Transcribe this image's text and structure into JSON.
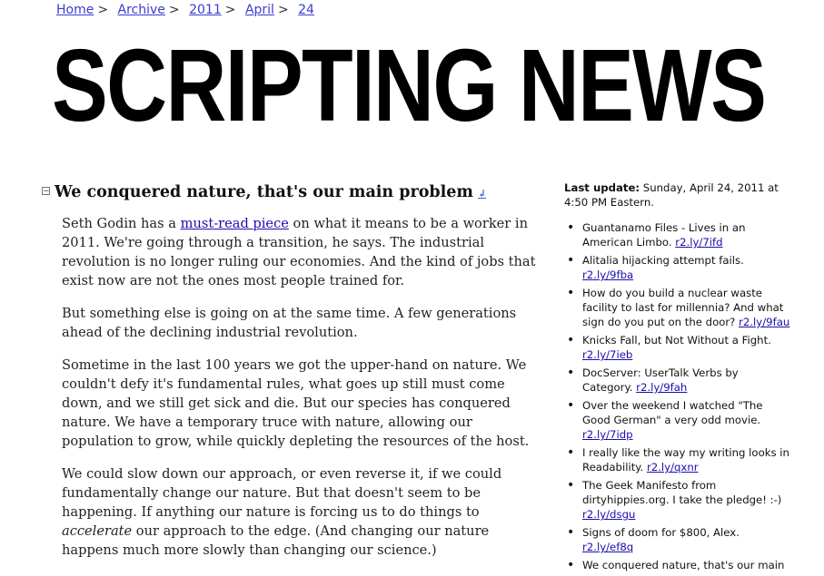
{
  "breadcrumb": [
    "Home",
    "Archive",
    "2011",
    "April",
    "24"
  ],
  "masthead": "SCRIPTING NEWS",
  "post": {
    "title": "We conquered nature, that's our main problem",
    "p1_a": "Seth Godin has a ",
    "p1_link": "must-read piece",
    "p1_b": " on what it means to be a worker in 2011. We're going through a transition, he says. The industrial revolution is no longer ruling our economies. And the kind of jobs that exist now are not the ones most people trained for.",
    "p2": "But something else is going on at the same time. A few generations ahead of the declining industrial revolution.",
    "p3": "Sometime in the last 100 years we got the upper-hand on nature. We couldn't defy it's fundamental rules, what goes up still must come down, and we still get sick and die. But our species has conquered nature. We have a temporary truce with nature, allowing our population to grow, while quickly depleting the resources of the host.",
    "p4_a": "We could slow down our approach, or even reverse it, if we could fundamentally change our nature. But that doesn't seem to be happening. If anything our nature is forcing us to do things to ",
    "p4_em": "accelerate",
    "p4_b": " our approach to the edge. (And changing our nature happens much more slowly than changing our science.)"
  },
  "sidebar": {
    "last_update_label": "Last update:",
    "last_update_value": " Sunday, April 24, 2011 at 4:50 PM Eastern.",
    "links": [
      {
        "text": "Guantanamo Files - Lives in an American Limbo. ",
        "url": "r2.ly/7ifd"
      },
      {
        "text": "Alitalia hijacking attempt fails. ",
        "url": "r2.ly/9fba"
      },
      {
        "text": "How do you build a nuclear waste facility to last for millennia? And what sign do you put on the door? ",
        "url": "r2.ly/9fau"
      },
      {
        "text": "Knicks Fall, but Not Without a Fight. ",
        "url": "r2.ly/7ieb"
      },
      {
        "text": "DocServer: UserTalk Verbs by Category. ",
        "url": "r2.ly/9fah"
      },
      {
        "text": "Over the weekend I watched \"The Good German\" a very odd movie. ",
        "url": "r2.ly/7idp"
      },
      {
        "text": "I really like the way my writing looks in Readability. ",
        "url": "r2.ly/qxnr"
      },
      {
        "text": "The Geek Manifesto from dirtyhippies.org. I take the pledge! :-) ",
        "url": "r2.ly/dsgu"
      },
      {
        "text": "Signs of doom for $800, Alex. ",
        "url": "r2.ly/ef8q"
      },
      {
        "text": "We conquered nature, that's our main ",
        "url": ""
      }
    ]
  }
}
